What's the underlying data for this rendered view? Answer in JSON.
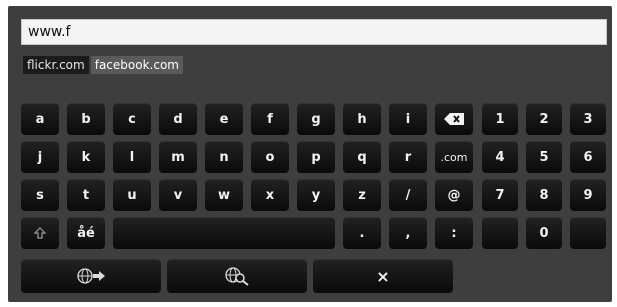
{
  "url_input": {
    "value": "www.f"
  },
  "suggestions": [
    "flickr.com",
    "facebook.com"
  ],
  "letter_rows": [
    [
      "a",
      "b",
      "c",
      "d",
      "e",
      "f",
      "g",
      "h",
      "i"
    ],
    [
      "j",
      "k",
      "l",
      "m",
      "n",
      "o",
      "p",
      "q",
      "r"
    ],
    [
      "s",
      "t",
      "u",
      "v",
      "w",
      "x",
      "y",
      "z",
      "/"
    ]
  ],
  "special_keys": {
    "dotcom": ".com",
    "at": "@",
    "accent": "åé",
    "dot": ".",
    "comma": ",",
    "colon": ":"
  },
  "numpad": {
    "rows": [
      [
        "1",
        "2",
        "3"
      ],
      [
        "4",
        "5",
        "6"
      ],
      [
        "7",
        "8",
        "9"
      ]
    ],
    "zero": "0"
  },
  "bottom_keys": {
    "close": "×"
  },
  "icons": {
    "backspace": "backspace-icon",
    "shift": "shift-icon",
    "go": "go-url-icon",
    "search": "web-search-icon"
  }
}
